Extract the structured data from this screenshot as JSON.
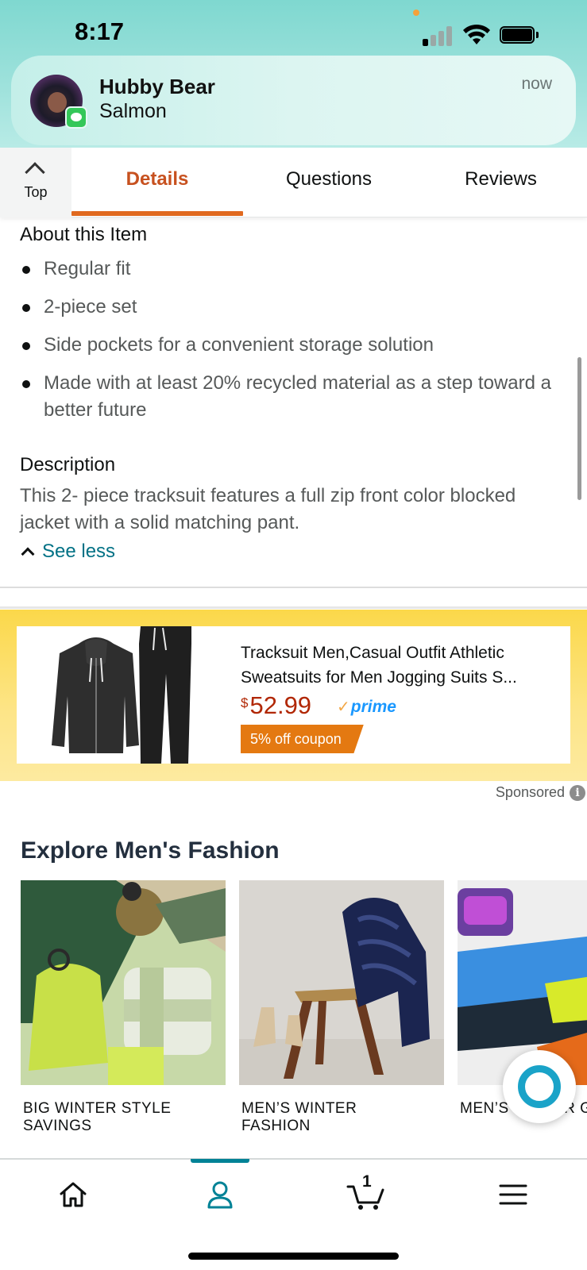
{
  "status_bar": {
    "time": "8:17"
  },
  "notification": {
    "sender": "Hubby Bear",
    "message": "Salmon",
    "time": "now"
  },
  "tabs": {
    "top_label": "Top",
    "items": [
      {
        "label": "Details",
        "active": true
      },
      {
        "label": "Questions",
        "active": false
      },
      {
        "label": "Reviews",
        "active": false
      }
    ]
  },
  "about": {
    "heading": "About this Item",
    "bullets": [
      "Regular fit",
      "2-piece set",
      "Side pockets for a convenient storage solution",
      "Made with at least 20% recycled material as a step toward a better future"
    ]
  },
  "description": {
    "heading": "Description",
    "text": "This 2- piece tracksuit features a full zip front color blocked jacket with a solid matching pant.",
    "see_less": "See less"
  },
  "ad": {
    "title": "Tracksuit Men,Casual Outfit Athletic Sweatsuits for Men Jogging Suits S...",
    "currency": "$",
    "price": "52.99",
    "prime": "prime",
    "coupon": "5% off coupon",
    "sponsored": "Sponsored",
    "info_glyph": "i"
  },
  "explore": {
    "title": "Explore Men's Fashion",
    "tiles": [
      {
        "label_line1": "BIG WINTER STYLE",
        "label_line2": "SAVINGS"
      },
      {
        "label_line1": "MEN’S WINTER",
        "label_line2": "FASHION"
      },
      {
        "label_line1": "MEN’S WINTER GEAR",
        "label_line2": ""
      }
    ]
  },
  "bottom_nav": {
    "items": [
      "home-icon",
      "account-icon",
      "cart-icon",
      "menu-icon"
    ],
    "active": "account-icon",
    "cart_count": "1"
  },
  "colors": {
    "accent_orange": "#c7511f",
    "link_teal": "#007185",
    "price_red": "#b12704",
    "prime_blue": "#1a98ff",
    "coupon_orange": "#e47911",
    "nav_teal": "#008296"
  }
}
